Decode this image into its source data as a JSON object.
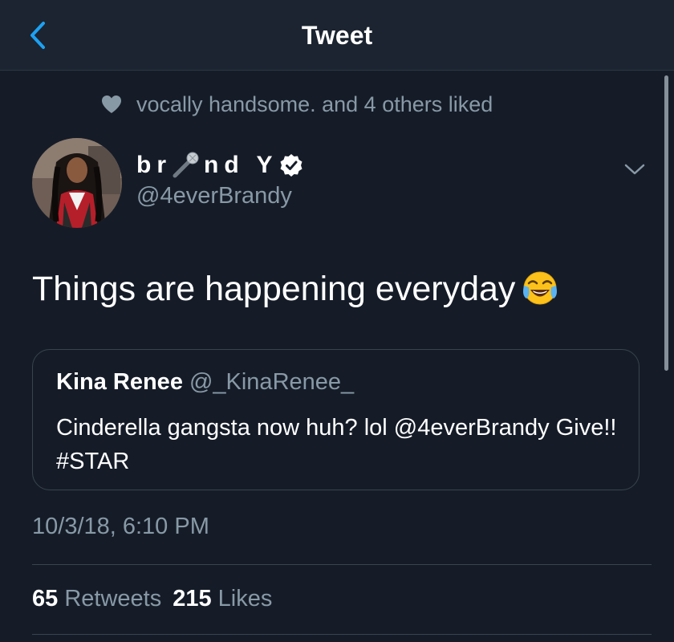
{
  "navbar": {
    "title": "Tweet",
    "back_icon": "chevron-left-icon"
  },
  "social_context": {
    "icon": "heart-icon",
    "text": "vocally handsome. and 4 others liked"
  },
  "author": {
    "display_name": "br 🎤 nd Y",
    "display_name_parts": [
      "br",
      "nd Y"
    ],
    "verified": true,
    "username": "@4everBrandy"
  },
  "tweet": {
    "text": "Things are happening everyday",
    "emoji": "face-with-tears-of-joy"
  },
  "quoted_tweet": {
    "name": "Kina Renee",
    "handle": "@_KinaRenee_",
    "text": "Cinderella gangsta now huh? lol @4everBrandy Give!! #STAR"
  },
  "timestamp": "10/3/18, 6:10 PM",
  "stats": {
    "retweets_count": "65",
    "retweets_label": "Retweets",
    "likes_count": "215",
    "likes_label": "Likes"
  },
  "colors": {
    "background": "#151c28",
    "navbar": "#1b2430",
    "accent": "#1da1f2",
    "secondary_text": "#8899a6",
    "border": "#38444d"
  }
}
